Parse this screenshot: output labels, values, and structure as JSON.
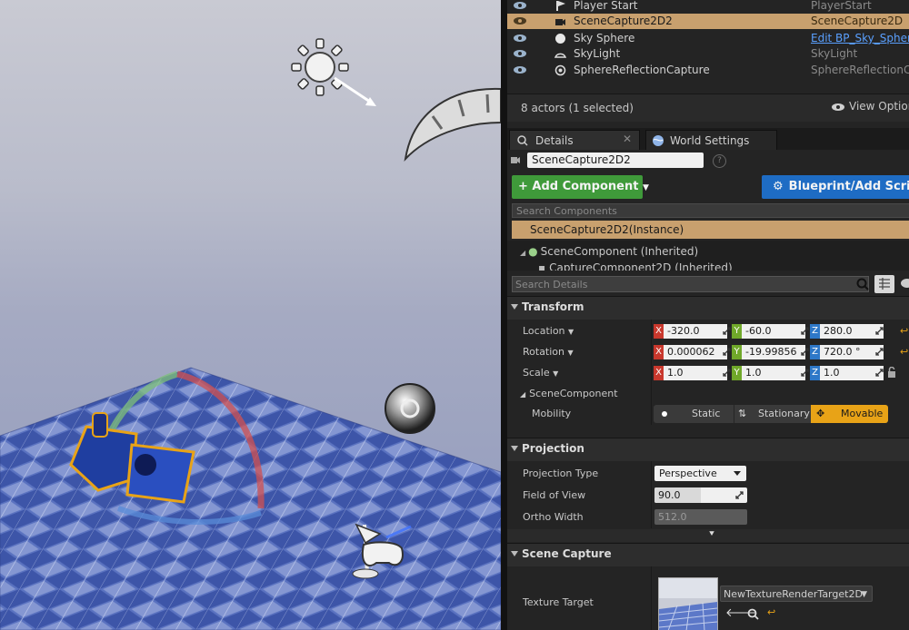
{
  "outliner": {
    "rows": [
      {
        "name": "Player Start",
        "type": "PlayerStart",
        "selected": false
      },
      {
        "name": "SceneCapture2D2",
        "type": "SceneCapture2D",
        "selected": true
      },
      {
        "name": "Sky Sphere",
        "type": "Edit BP_Sky_Sphere",
        "selected": false
      },
      {
        "name": "SkyLight",
        "type": "SkyLight",
        "selected": false
      },
      {
        "name": "SphereReflectionCapture",
        "type": "SphereReflectionCapture",
        "selected": false
      }
    ],
    "actor_count": "8 actors (1 selected)",
    "view_options": "View Options"
  },
  "tabs": {
    "details": "Details",
    "world_settings": "World Settings"
  },
  "details": {
    "actor_name": "SceneCapture2D2",
    "add_component": "+ Add Component",
    "blueprint_button": "Blueprint/Add Script",
    "search_components_placeholder": "Search Components",
    "instance_label": "SceneCapture2D2(Instance)",
    "tree": {
      "scene_component": "SceneComponent (Inherited)",
      "capture_component": "CaptureComponent2D (Inherited)"
    },
    "search_details_placeholder": "Search Details"
  },
  "transform": {
    "header": "Transform",
    "location_label": "Location",
    "rotation_label": "Rotation",
    "scale_label": "Scale",
    "location": {
      "x": "-320.0",
      "y": "-60.0",
      "z": "280.0"
    },
    "rotation": {
      "x": "0.000062",
      "y": "-19.99856",
      "z": "720.0 °"
    },
    "scale": {
      "x": "1.0",
      "y": "1.0",
      "z": "1.0"
    },
    "scene_component_label": "SceneComponent",
    "mobility_label": "Mobility",
    "mobility_options": [
      "Static",
      "Stationary",
      "Movable"
    ],
    "mobility_selected": "Movable"
  },
  "projection": {
    "header": "Projection",
    "projection_type_label": "Projection Type",
    "projection_type_value": "Perspective",
    "fov_label": "Field of View",
    "fov_value": "90.0",
    "fov_fraction": 0.5,
    "ortho_label": "Ortho Width",
    "ortho_value": "512.0"
  },
  "scene_capture": {
    "header": "Scene Capture",
    "texture_target_label": "Texture Target",
    "texture_target_value": "NewTextureRenderTarget2D"
  },
  "colors": {
    "selection": "#c8a06e",
    "add_component": "#3f9a3a",
    "blueprint": "#1e6cc4",
    "movable": "#e8a317",
    "axis_x": "#c8382d",
    "axis_y": "#70a82a",
    "axis_z": "#2e78c8"
  },
  "icons": {
    "outliner_visibility": "eye-icon",
    "view_options": "eye-icon",
    "details_tab": "details-icon",
    "world_settings_tab": "globe-icon",
    "search": "magnifier-icon",
    "blueprint": "gears-icon",
    "mobility_static": "dot-icon",
    "mobility_stationary": "stationary-icon",
    "mobility_movable": "move-arrows-icon",
    "reset": "reset-arrow-icon",
    "lock": "lock-icon",
    "use_asset": "arrow-left-icon",
    "browse_asset": "magnifier-icon"
  }
}
